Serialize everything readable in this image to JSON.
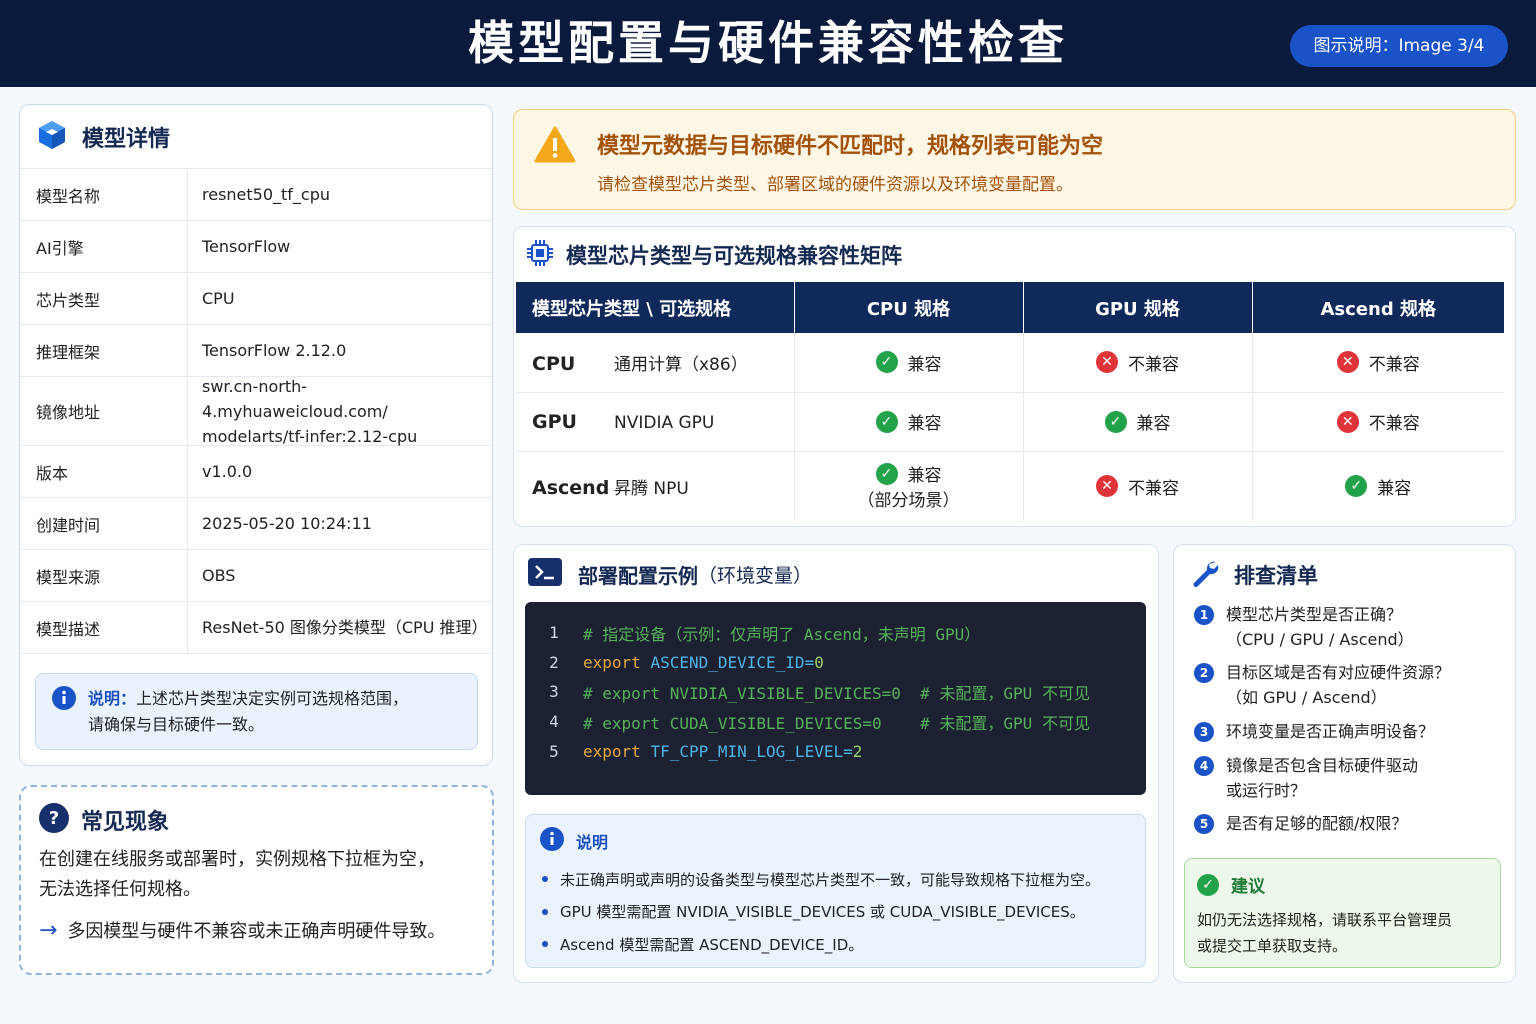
{
  "header": {
    "title": "模型配置与硬件兼容性检查",
    "badge": "图示说明：Image 3/4"
  },
  "model_card": {
    "title": "模型详情",
    "rows": [
      {
        "key": "模型名称",
        "value": "resnet50_tf_cpu"
      },
      {
        "key": "AI引擎",
        "value": "TensorFlow"
      },
      {
        "key": "芯片类型",
        "value": "CPU"
      },
      {
        "key": "推理框架",
        "value": "TensorFlow 2.12.0"
      },
      {
        "key": "镜像地址",
        "value_line1": "swr.cn-north-4.myhuaweicloud.com/",
        "value_line2": "modelarts/tf-infer:2.12-cpu"
      },
      {
        "key": "版本",
        "value": "v1.0.0"
      },
      {
        "key": "创建时间",
        "value": "2025-05-20 10:24:11"
      },
      {
        "key": "模型来源",
        "value": "OBS"
      },
      {
        "key": "模型描述",
        "value": "ResNet-50 图像分类模型（CPU 推理）"
      }
    ],
    "note_label": "说明：",
    "note_line1": "上述芯片类型决定实例可选规格范围，",
    "note_line2": "请确保与目标硬件一致。"
  },
  "phenomena": {
    "title": "常见现象",
    "line1": "在创建在线服务或部署时，实例规格下拉框为空，",
    "line2": "无法选择任何规格。",
    "arrow_text": "多因模型与硬件不兼容或未正确声明硬件导致。"
  },
  "warning": {
    "title": "模型元数据与目标硬件不匹配时，规格列表可能为空",
    "subtitle": "请检查模型芯片类型、部署区域的硬件资源以及环境变量配置。"
  },
  "matrix": {
    "title": "模型芯片类型与可选规格兼容性矩阵",
    "headers": [
      "模型芯片类型 \\ 可选规格",
      "CPU 规格",
      "GPU 规格",
      "Ascend 规格"
    ],
    "rows": [
      {
        "key": "CPU",
        "desc": "通用计算（x86）",
        "cells": [
          "兼容",
          "不兼容",
          "不兼容"
        ]
      },
      {
        "key": "GPU",
        "desc": "NVIDIA GPU",
        "cells": [
          "兼容",
          "兼容",
          "不兼容"
        ]
      },
      {
        "key": "Ascend",
        "desc": "昇腾 NPU",
        "cells": [
          "兼容",
          "不兼容",
          "兼容"
        ],
        "cell0_note": "（部分场景）"
      }
    ]
  },
  "deploy": {
    "title": "部署配置示例",
    "title_suffix": "（环境变量）",
    "code": {
      "l1": "# 指定设备（示例：仅声明了 Ascend，未声明 GPU）",
      "l2_kw": "export",
      "l2_var": "ASCEND_DEVICE_ID",
      "l2_eq": "=",
      "l2_val": "0",
      "l3": "# export NVIDIA_VISIBLE_DEVICES=0  # 未配置，GPU 不可见",
      "l4": "# export CUDA_VISIBLE_DEVICES=0    # 未配置，GPU 不可见",
      "l5_kw": "export",
      "l5_var": "TF_CPP_MIN_LOG_LEVEL",
      "l5_eq": "=",
      "l5_val": "2",
      "line_numbers": [
        "1",
        "2",
        "3",
        "4",
        "5"
      ]
    },
    "note_title": "说明",
    "notes": [
      "未正确声明或声明的设备类型与模型芯片类型不一致，可能导致规格下拉框为空。",
      "GPU 模型需配置 NVIDIA_VISIBLE_DEVICES 或 CUDA_VISIBLE_DEVICES。",
      "Ascend 模型需配置 ASCEND_DEVICE_ID。"
    ]
  },
  "checklist": {
    "title": "排查清单",
    "items": [
      {
        "num": "1",
        "line1": "模型芯片类型是否正确？",
        "line2": "（CPU / GPU / Ascend）"
      },
      {
        "num": "2",
        "line1": "目标区域是否有对应硬件资源？",
        "line2": "（如 GPU / Ascend）"
      },
      {
        "num": "3",
        "line1": "环境变量是否正确声明设备？",
        "line2": ""
      },
      {
        "num": "4",
        "line1": "镜像是否包含目标硬件驱动",
        "line2": "或运行时？"
      },
      {
        "num": "5",
        "line1": "是否有足够的配额/权限？",
        "line2": ""
      }
    ],
    "advice_title": "建议",
    "advice_line1": "如仍无法选择规格，请联系平台管理员",
    "advice_line2": "或提交工单获取支持。"
  },
  "colors": {
    "header_bg": "#0a1a3c",
    "accent": "#1a53c7",
    "ok": "#22a34a",
    "error": "#e0343a",
    "warn": "#a3520b"
  }
}
